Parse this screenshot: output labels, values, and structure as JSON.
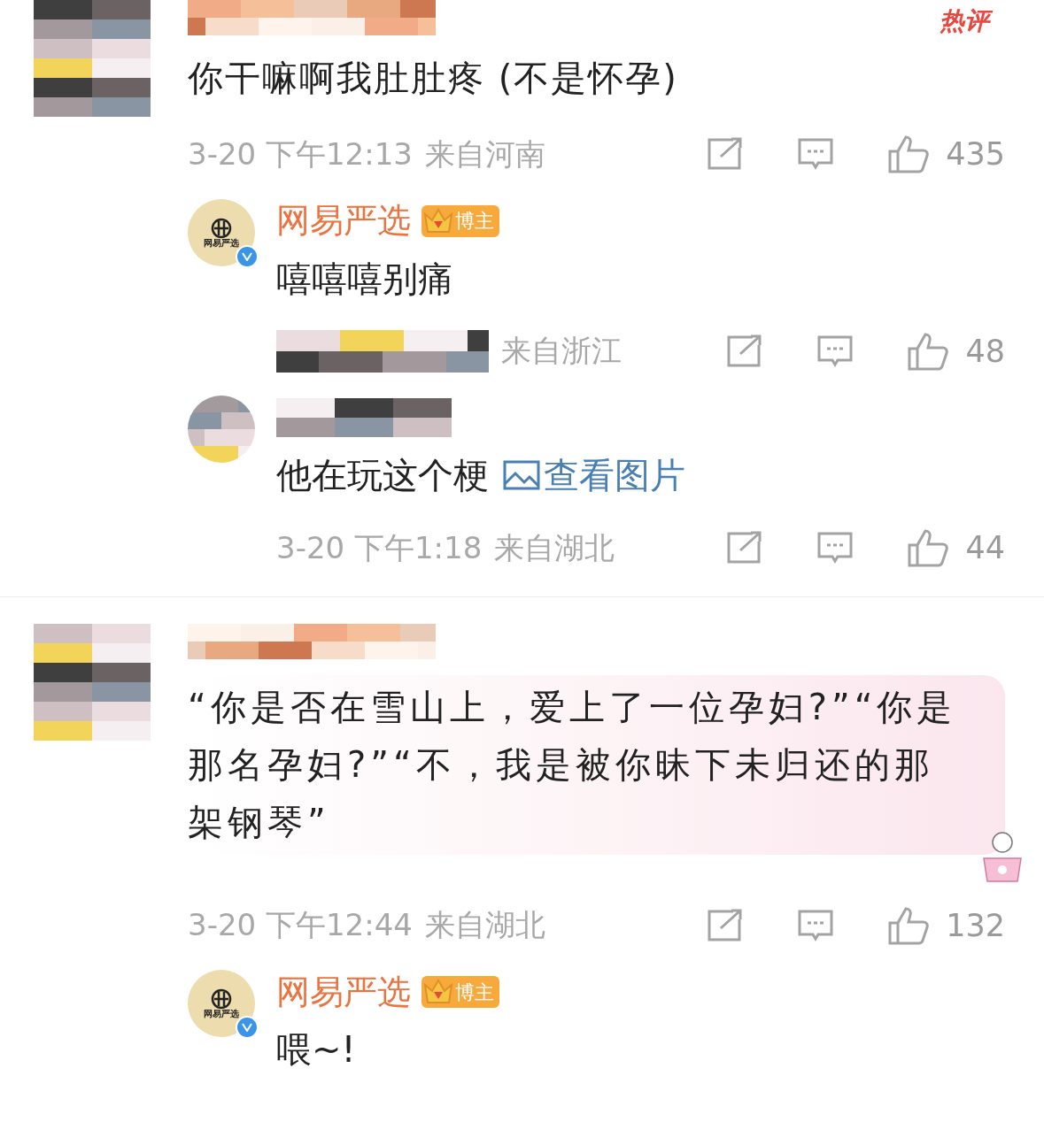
{
  "comments": [
    {
      "tag": "热评",
      "text": "你干嘛啊我肚肚疼 (不是怀孕)",
      "bubble": false,
      "time": "3-20 下午12:13",
      "location": "来自河南",
      "likes": "435",
      "replies": [
        {
          "author": "网易严选",
          "avatar_text": "网易严选",
          "verified": true,
          "badge": "博主",
          "text": "嘻嘻嘻别痛",
          "location": "来自浙江",
          "likes": "48"
        },
        {
          "verified": false,
          "text": "他在玩这个梗",
          "link": "查看图片",
          "time": "3-20 下午1:18",
          "location": "来自湖北",
          "likes": "44"
        }
      ]
    },
    {
      "text": "“你是否在雪山上，爱上了一位孕妇?”“你是那名孕妇?”“不，我是被你昧下未归还的那架钢琴”",
      "bubble": true,
      "time": "3-20 下午12:44",
      "location": "来自湖北",
      "likes": "132",
      "replies": [
        {
          "author": "网易严选",
          "avatar_text": "网易严选",
          "verified": true,
          "badge": "博主",
          "text": "喂~!"
        }
      ]
    }
  ]
}
